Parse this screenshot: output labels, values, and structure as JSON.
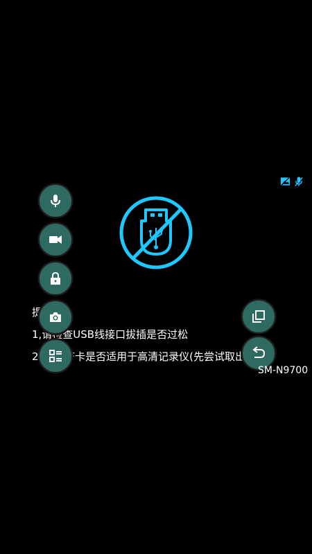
{
  "status": {
    "icons": [
      "no-image-icon",
      "mic-off-icon"
    ],
    "accent_color": "#1ec8ff"
  },
  "warning": {
    "icon": "usb-disconnected-icon",
    "accent_color": "#1ec8ff"
  },
  "tips": {
    "heading": "提示",
    "line1": "1,请检查USB线接口拔插是否过松",
    "line2": "2,检查TF卡是否适用于高清记录仪(先尝试取出TF卡"
  },
  "device": {
    "model": "SM-N9700"
  },
  "left_buttons": [
    "mic-icon",
    "video-camera-icon",
    "lock-icon",
    "camera-icon",
    "menu-list-icon"
  ],
  "right_buttons": [
    "copy-icon",
    "undo-icon"
  ],
  "button_color": "#2e6a61"
}
